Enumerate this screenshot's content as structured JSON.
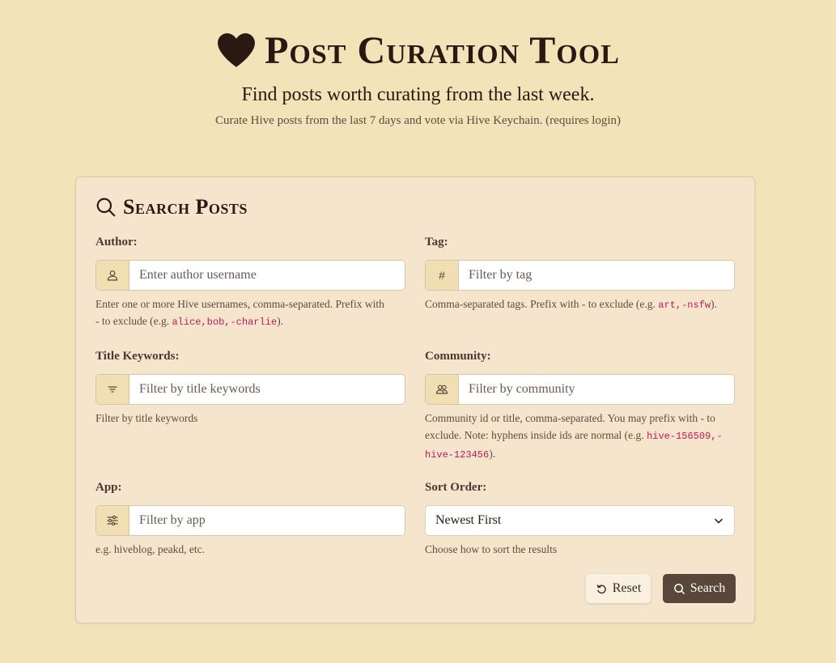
{
  "header": {
    "title": "Post Curation Tool",
    "subtitle": "Find posts worth curating from the last week.",
    "description": "Curate Hive posts from the last 7 days and vote via Hive Keychain. (requires login)",
    "logo_icon": "heart-icon"
  },
  "search": {
    "title": "Search Posts",
    "icon": "search-icon",
    "author": {
      "label": "Author:",
      "placeholder": "Enter author username",
      "icon": "user-icon",
      "help_pre": "Enter one or more Hive usernames, comma-separated. Prefix with",
      "help_dash": "-",
      "help_mid": "to exclude (e.g.",
      "help_code": "alice,bob,-charlie",
      "help_post": ")."
    },
    "tag": {
      "label": "Tag:",
      "placeholder": "Filter by tag",
      "icon_text": "#",
      "help_pre": "Comma-separated tags. Prefix with",
      "help_dash": "-",
      "help_mid": "to exclude (e.g.",
      "help_code": "art,-nsfw",
      "help_post": ")."
    },
    "title_keywords": {
      "label": "Title Keywords:",
      "placeholder": "Filter by title keywords",
      "icon": "filter-icon",
      "help": "Filter by title keywords"
    },
    "community": {
      "label": "Community:",
      "placeholder": "Filter by community",
      "icon": "people-icon",
      "help_pre": "Community id or title, comma-separated. You may prefix with",
      "help_dash": "-",
      "help_mid": "to exclude. Note: hyphens inside ids are normal (e.g.",
      "help_code": "hive-156509,-hive-123456",
      "help_post": ")."
    },
    "app": {
      "label": "App:",
      "placeholder": "Filter by app",
      "icon": "sliders-icon",
      "help": "e.g. hiveblog, peakd, etc."
    },
    "sort": {
      "label": "Sort Order:",
      "selected": "Newest First",
      "help": "Choose how to sort the results"
    },
    "reset_label": "Reset",
    "search_label": "Search"
  },
  "colors": {
    "background": "#f3e3b9",
    "card": "#f5e5cd",
    "accent_button": "#5b463b",
    "code": "#c2185b"
  }
}
